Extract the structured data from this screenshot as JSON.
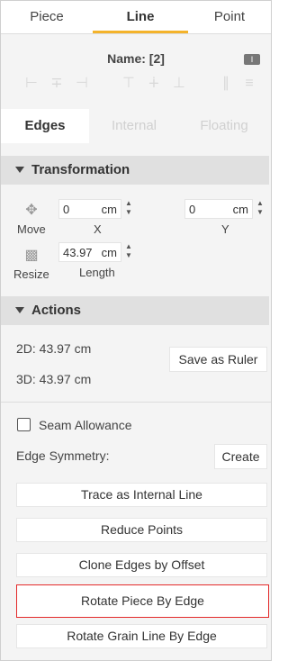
{
  "tabs": [
    "Piece",
    "Line",
    "Point"
  ],
  "name_label": "Name: [2]",
  "name_icon": "I",
  "align_icons": [
    "align-left-icon",
    "align-center-h-icon",
    "align-right-icon",
    "align-top-icon",
    "align-middle-v-icon",
    "align-bottom-icon",
    "distribute-h-icon",
    "distribute-v-icon"
  ],
  "subtabs": [
    "Edges",
    "Internal",
    "Floating"
  ],
  "transformation": {
    "title": "Transformation",
    "move_label": "Move",
    "x_value": "0",
    "x_unit": "cm",
    "x_label": "X",
    "y_value": "0",
    "y_unit": "cm",
    "y_label": "Y",
    "resize_label": "Resize",
    "length_value": "43.97",
    "length_unit": "cm",
    "length_label": "Length"
  },
  "actions": {
    "title": "Actions",
    "len_2d": "2D: 43.97 cm",
    "len_3d": "3D: 43.97 cm",
    "save_ruler": "Save as Ruler"
  },
  "seam_allowance": "Seam Allowance",
  "edge_symmetry": "Edge Symmetry:",
  "create": "Create",
  "buttons": [
    "Trace as Internal Line",
    "Reduce Points",
    "Clone Edges by Offset",
    "Rotate Piece By Edge",
    "Rotate Grain Line By Edge"
  ],
  "colors": {
    "accent": "#f4b32a",
    "highlight": "#e32a2a"
  }
}
